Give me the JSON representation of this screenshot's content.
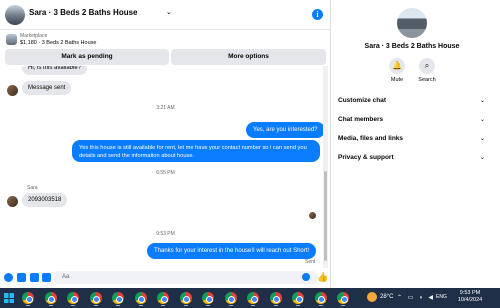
{
  "header": {
    "title": "Sara · 3 Beds 2 Baths House",
    "chevron_icon": "chevron-down-icon",
    "info_icon": "info-icon",
    "info_glyph": "i"
  },
  "marketplace": {
    "label": "Marketplace",
    "item": "$1,180 · 3 Beds 2 Baths House",
    "pending_button": "Mark as pending",
    "more_button": "More options"
  },
  "messages": [
    {
      "type": "incoming",
      "text": "Hi, is this available?"
    },
    {
      "type": "incoming",
      "text": "Message sent"
    },
    {
      "type": "time",
      "text": "3:21 AM"
    },
    {
      "type": "outgoing",
      "text": "Yes, are you interested?"
    },
    {
      "type": "outgoing",
      "text": "Yes this house is still available for rent, let me have your contact number so i can send you details and send the information about house."
    },
    {
      "type": "time",
      "text": "6:55 PM"
    },
    {
      "type": "sender",
      "text": "Sara"
    },
    {
      "type": "incoming",
      "text": "2093003518"
    },
    {
      "type": "time",
      "text": "9:53 PM"
    },
    {
      "type": "outgoing",
      "text": "Thanks for your interest in the house!I will reach out Short!"
    }
  ],
  "sent_label": "Sent",
  "composer": {
    "placeholder": "Aa",
    "icons": [
      "plus-circle-icon",
      "image-icon",
      "sticker-icon",
      "gif-icon",
      "emoji-icon",
      "like-icon"
    ],
    "like_glyph": "👍"
  },
  "side": {
    "title": "Sara · 3 Beds 2 Baths House",
    "mute_label": "Mute",
    "search_label": "Search",
    "mute_glyph": "🔔",
    "search_glyph": "⌕",
    "rows": [
      "Customize chat",
      "Chat members",
      "Media, files and links",
      "Privacy & support"
    ],
    "row_chevron": "⌄"
  },
  "taskbar": {
    "temperature": "28°C",
    "language": "ENG",
    "time": "9:53 PM",
    "date": "10/4/2024",
    "tray_glyphs": "⌃ ▭ ◖ ◀"
  },
  "colors": {
    "accent": "#0a7cff",
    "bubble_in": "#e4e6eb",
    "taskbar": "#1f2f47"
  }
}
